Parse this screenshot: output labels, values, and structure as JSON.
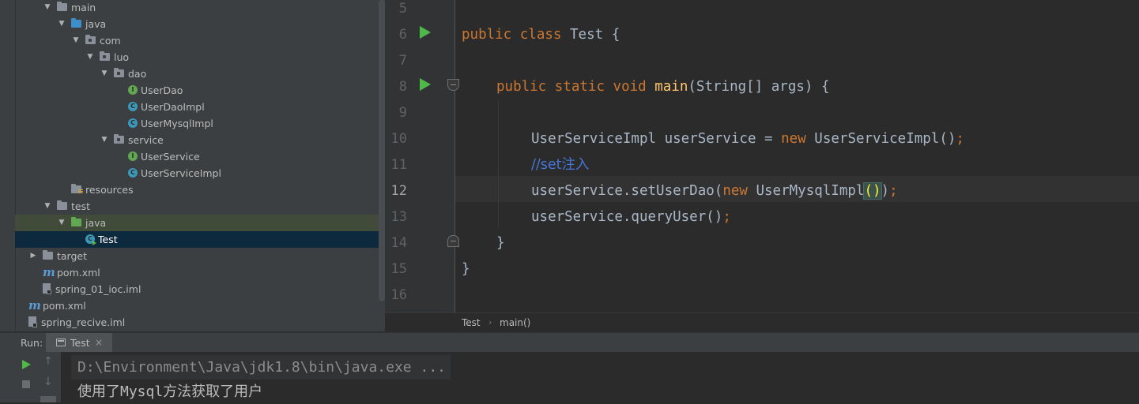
{
  "project_tree": [
    {
      "label": "main",
      "kind": "folder",
      "depth": 3,
      "arrow": "down"
    },
    {
      "label": "java",
      "kind": "folder-blue",
      "depth": 4,
      "arrow": "down"
    },
    {
      "label": "com",
      "kind": "package",
      "depth": 5,
      "arrow": "down"
    },
    {
      "label": "luo",
      "kind": "package",
      "depth": 6,
      "arrow": "down"
    },
    {
      "label": "dao",
      "kind": "package",
      "depth": 7,
      "arrow": "down"
    },
    {
      "label": "UserDao",
      "kind": "interface",
      "depth": 8,
      "arrow": ""
    },
    {
      "label": "UserDaoImpl",
      "kind": "class",
      "depth": 8,
      "arrow": ""
    },
    {
      "label": "UserMysqlImpl",
      "kind": "class",
      "depth": 8,
      "arrow": ""
    },
    {
      "label": "service",
      "kind": "package",
      "depth": 7,
      "arrow": "down"
    },
    {
      "label": "UserService",
      "kind": "interface",
      "depth": 8,
      "arrow": ""
    },
    {
      "label": "UserServiceImpl",
      "kind": "class",
      "depth": 8,
      "arrow": ""
    },
    {
      "label": "resources",
      "kind": "resources",
      "depth": 4,
      "arrow": ""
    },
    {
      "label": "test",
      "kind": "folder",
      "depth": 3,
      "arrow": "down"
    },
    {
      "label": "java",
      "kind": "folder-green",
      "depth": 4,
      "arrow": "down",
      "state": "highlighted"
    },
    {
      "label": "Test",
      "kind": "run-class",
      "depth": 5,
      "arrow": "",
      "state": "selected"
    },
    {
      "label": "target",
      "kind": "folder",
      "depth": 2,
      "arrow": "right"
    },
    {
      "label": "pom.xml",
      "kind": "maven",
      "depth": 2,
      "arrow": ""
    },
    {
      "label": "spring_01_ioc.iml",
      "kind": "iml",
      "depth": 2,
      "arrow": ""
    },
    {
      "label": "pom.xml",
      "kind": "maven",
      "depth": 1,
      "arrow": ""
    },
    {
      "label": "spring_recive.iml",
      "kind": "iml",
      "depth": 1,
      "arrow": ""
    }
  ],
  "editor": {
    "line_numbers": [
      "5",
      "6",
      "7",
      "8",
      "9",
      "10",
      "11",
      "12",
      "13",
      "14",
      "15",
      "16"
    ],
    "current_line": "12",
    "lines": {
      "l6": {
        "kw1": "public",
        "kw2": "class",
        "name": "Test",
        "brace": "{"
      },
      "l8": {
        "kw1": "public",
        "kw2": "static",
        "kw3": "void",
        "fn": "main",
        "params": "(String[] args)",
        "brace": "{"
      },
      "l10": {
        "type": "UserServiceImpl",
        "var": "userService",
        "eq": "=",
        "kw": "new",
        "ctor": "UserServiceImpl()",
        "semi": ";"
      },
      "l11": {
        "comment_prefix": "//",
        "comment": "set注入"
      },
      "l12": {
        "obj": "userService.setUserDao(",
        "kw": "new",
        "cls": "UserMysqlImpl",
        "paren": "()",
        "close": ")",
        "semi": ";"
      },
      "l13": {
        "call": "userService.queryUser()",
        "semi": ";"
      },
      "l14": {
        "brace": "}"
      },
      "l15": {
        "brace": "}"
      }
    }
  },
  "breadcrumb": {
    "class": "Test",
    "separator": "›",
    "method": "main()"
  },
  "run_panel": {
    "label": "Run:",
    "tab": "Test",
    "tab_close": "×",
    "up_icon": "↑",
    "down_icon": "↓",
    "console": {
      "command": "D:\\Environment\\Java\\jdk1.8\\bin\\java.exe ...",
      "output": "使用了Mysql方法获取了用户"
    }
  },
  "colors": {
    "editor_bg": "#2b2b2b",
    "panel_bg": "#3c3f41",
    "keyword": "#cc7832",
    "function": "#ffc66d",
    "comment": "#4776d6",
    "text": "#a9b7c6",
    "selection": "#0d293e",
    "run_green": "#4fb848"
  }
}
